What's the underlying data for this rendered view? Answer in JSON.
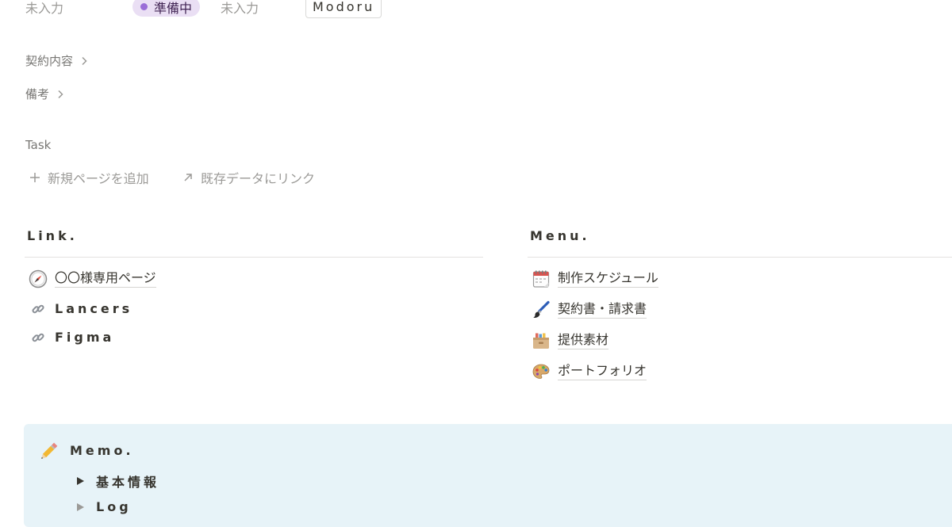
{
  "properties": {
    "empty_1": "未入力",
    "status": "準備中",
    "empty_2": "未入力",
    "tag": "Modoru",
    "colors": {
      "status_bg": "#eadff4",
      "status_dot": "#9a6dd7"
    }
  },
  "toggles": [
    {
      "label": "契約内容"
    },
    {
      "label": "備考"
    }
  ],
  "task": {
    "label": "Task",
    "add_new": "新規ページを追加",
    "link_existing": "既存データにリンク"
  },
  "link_section": {
    "heading": "Link.",
    "items": [
      {
        "icon": "compass-icon",
        "label": "〇〇様専用ページ"
      },
      {
        "icon": "link-icon",
        "label": "Lancers"
      },
      {
        "icon": "link-icon",
        "label": "Figma"
      }
    ]
  },
  "menu_section": {
    "heading": "Menu.",
    "items": [
      {
        "icon": "calendar-icon",
        "label": "制作スケジュール"
      },
      {
        "icon": "paintbrush-icon",
        "label": "契約書・請求書"
      },
      {
        "icon": "card-file-box-icon",
        "label": "提供素材"
      },
      {
        "icon": "palette-icon",
        "label": "ポートフォリオ"
      }
    ]
  },
  "memo": {
    "icon": "pencil-icon",
    "title": "Memo.",
    "toggles": [
      {
        "label": "基本情報"
      },
      {
        "label": "Log"
      }
    ],
    "background": "#e7f3f8"
  }
}
